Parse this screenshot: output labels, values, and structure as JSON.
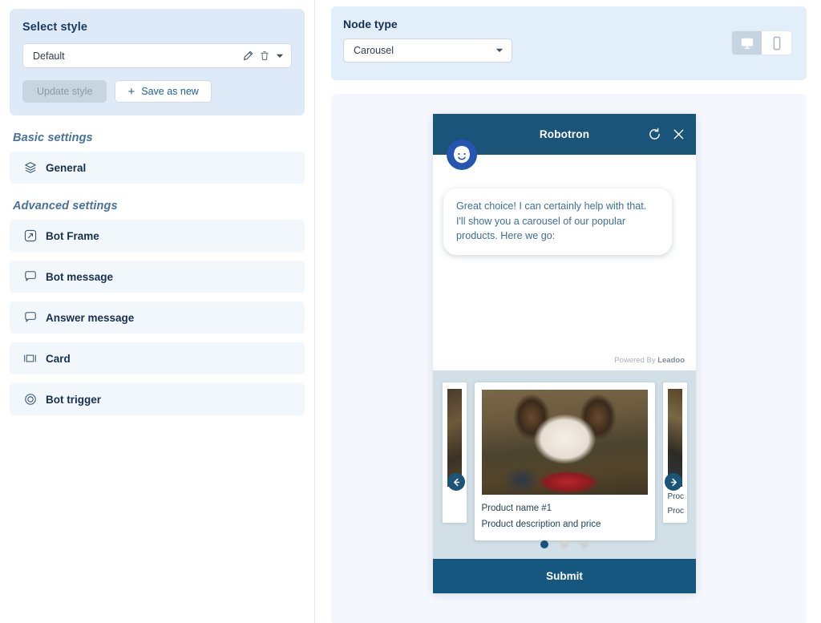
{
  "style_panel": {
    "title": "Select style",
    "selected_style": "Default",
    "edit_icon": "pencil-icon",
    "delete_icon": "trash-icon",
    "dropdown_icon": "chevron-down-icon",
    "update_label": "Update style",
    "save_label": "Save as new",
    "save_plus": "+"
  },
  "sidebar": {
    "sections": [
      {
        "heading": "Basic settings",
        "items": [
          {
            "label": "General",
            "icon": "layers-icon"
          }
        ]
      },
      {
        "heading": "Advanced settings",
        "items": [
          {
            "label": "Bot Frame",
            "icon": "frame-resize-icon"
          },
          {
            "label": "Bot message",
            "icon": "speech-bubble-icon"
          },
          {
            "label": "Answer message",
            "icon": "speech-bubble-icon"
          },
          {
            "label": "Card",
            "icon": "card-icon"
          },
          {
            "label": "Bot trigger",
            "icon": "target-circle-icon"
          }
        ]
      }
    ]
  },
  "node_panel": {
    "label": "Node type",
    "selected_node_type": "Carousel",
    "dropdown_icon": "chevron-down-icon",
    "devices": [
      {
        "name": "desktop-icon",
        "active": true
      },
      {
        "name": "mobile-icon",
        "active": false
      }
    ]
  },
  "widget": {
    "title": "Robotron",
    "refresh_icon": "refresh-icon",
    "close_icon": "close-icon",
    "avatar_icon": "bot-avatar-icon",
    "bot_message": "Great choice! I can certainly help with that. I'll show you a carousel of our popular products. Here we go:",
    "powered_prefix": "Powered By ",
    "powered_brand": "Leadoo",
    "carousel": {
      "prev_icon": "arrow-left-icon",
      "next_icon": "arrow-right-icon",
      "card": {
        "name": "Product name #1",
        "description": "Product description and price"
      },
      "peek_left_lines": [
        "",
        ""
      ],
      "peek_right_lines": [
        "Proc",
        "Proc"
      ],
      "dots": [
        true,
        false,
        false
      ]
    },
    "submit_label": "Submit"
  },
  "colors": {
    "brand_dark_blue": "#1b5479",
    "panel_blue": "#deeaf8",
    "accent_blue": "#1d5f9e",
    "carousel_bg": "#d2dfe6",
    "submit_bar": "#15577f",
    "avatar_ring": "#2455b0"
  }
}
